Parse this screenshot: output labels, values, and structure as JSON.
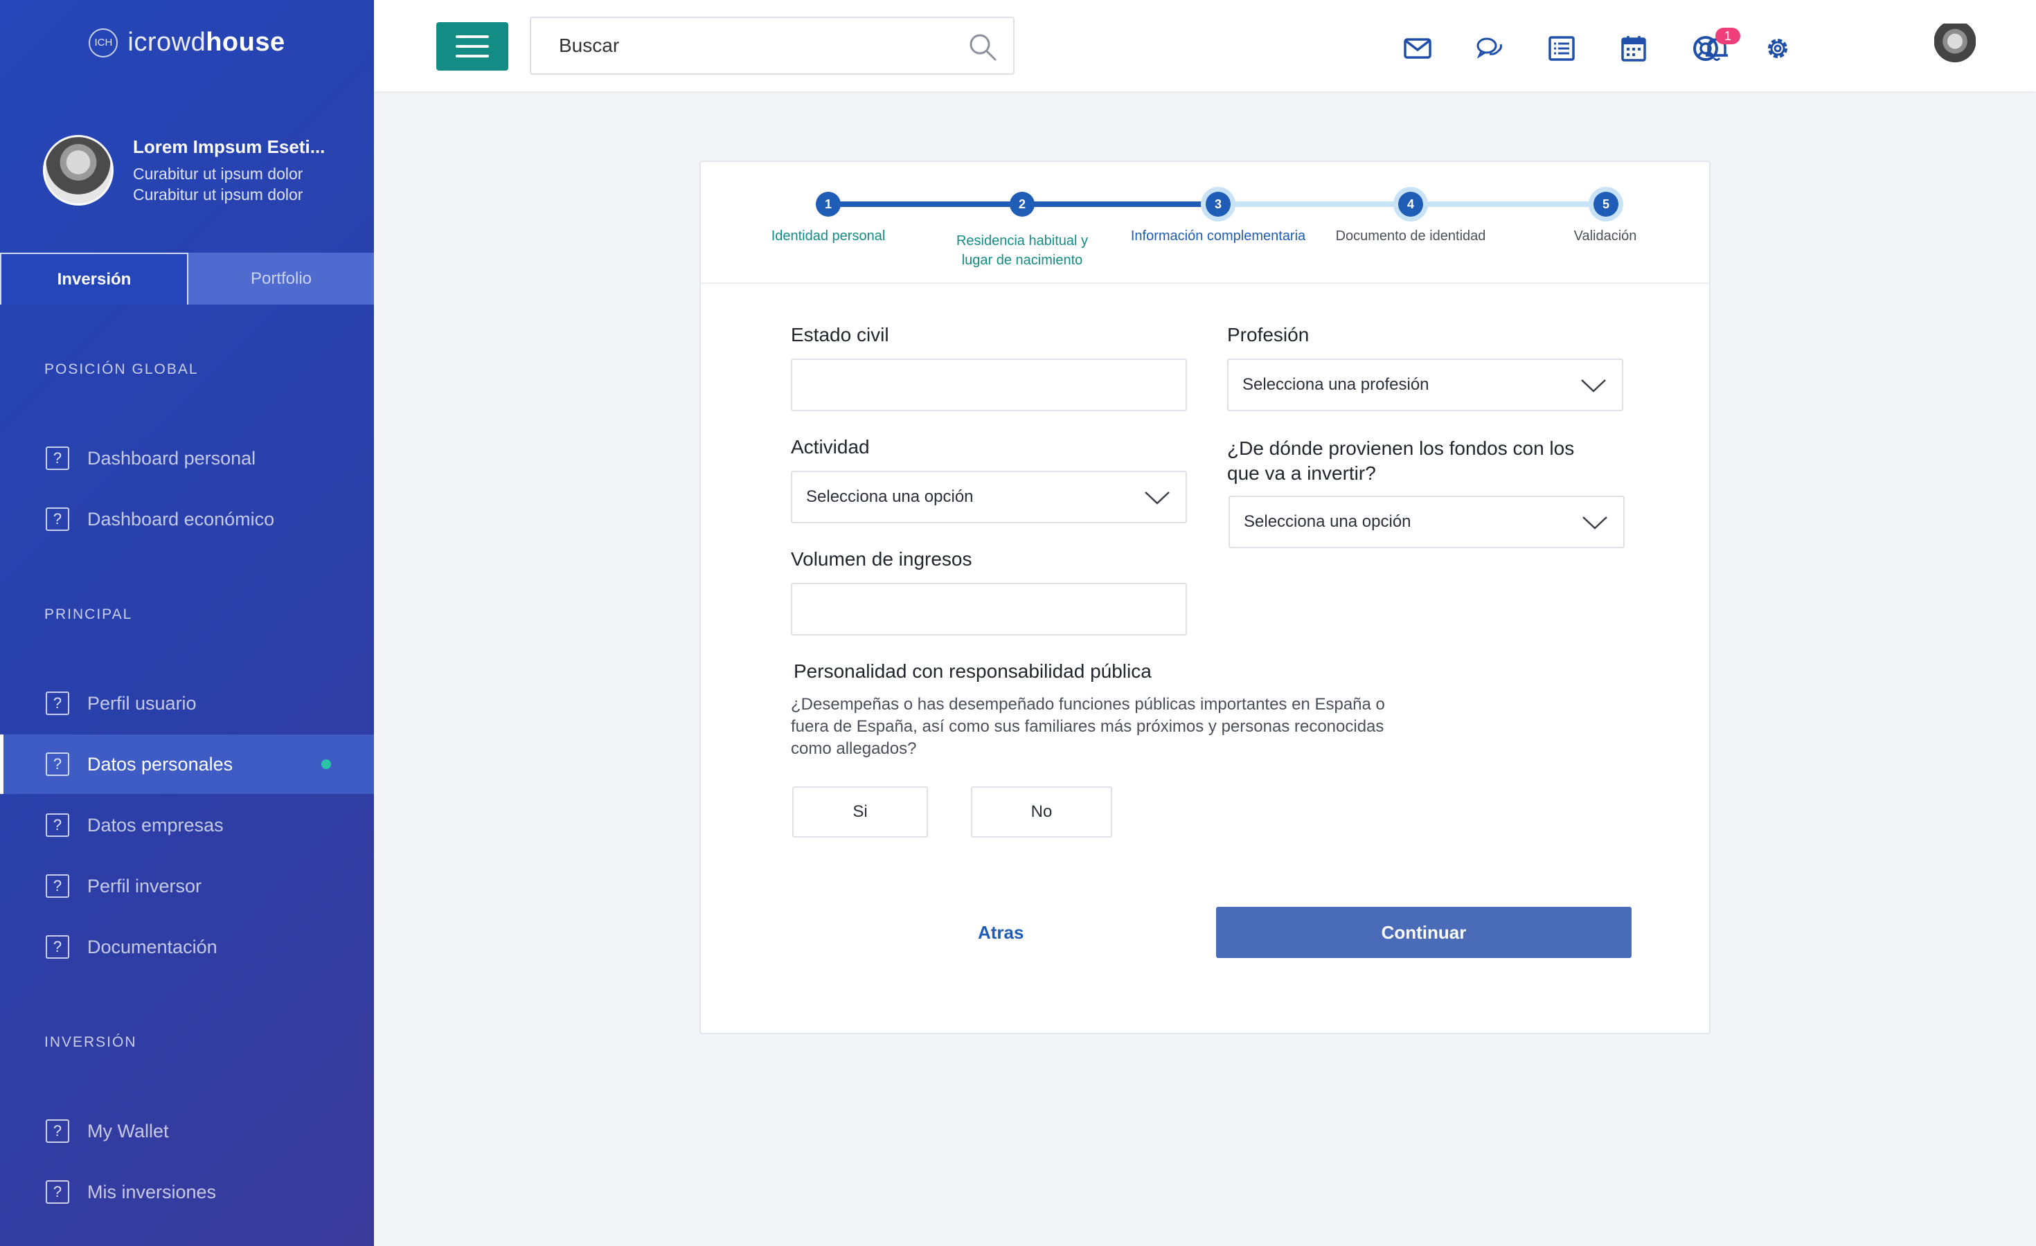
{
  "brand": {
    "mark": "ICH",
    "name_light": "icrowd",
    "name_bold": "house"
  },
  "user": {
    "name": "Lorem Impsum Eseti...",
    "line1": "Curabitur ut ipsum dolor",
    "line2": "Curabitur ut ipsum dolor"
  },
  "side_tabs": [
    {
      "label": "Inversión"
    },
    {
      "label": "Portfolio"
    }
  ],
  "sections": [
    "POSICIÓN GLOBAL",
    "PRINCIPAL",
    "INVERSIÓN"
  ],
  "nav": [
    {
      "label": "Dashboard personal"
    },
    {
      "label": "Dashboard económico"
    },
    {
      "label": "Perfil usuario"
    },
    {
      "label": "Datos personales"
    },
    {
      "label": "Datos empresas"
    },
    {
      "label": "Perfil inversor"
    },
    {
      "label": "Documentación"
    },
    {
      "label": "My Wallet"
    },
    {
      "label": "Mis inversiones"
    }
  ],
  "nav_icon_glyph": "?",
  "search": {
    "placeholder": "Buscar"
  },
  "notifications": {
    "count": "1"
  },
  "steps": [
    {
      "num": "1",
      "label1": "Identidad personal",
      "label2": ""
    },
    {
      "num": "2",
      "label1": "Residencia habitual y",
      "label2": "lugar de nacimiento"
    },
    {
      "num": "3",
      "label1": "Información complementaria",
      "label2": ""
    },
    {
      "num": "4",
      "label1": "Documento de identidad",
      "label2": ""
    },
    {
      "num": "5",
      "label1": "Validación",
      "label2": ""
    }
  ],
  "form": {
    "estado_civil": {
      "label": "Estado civil",
      "value": ""
    },
    "profesion": {
      "label": "Profesión",
      "value": "Selecciona una profesión"
    },
    "actividad": {
      "label": "Actividad",
      "value": "Selecciona una opción"
    },
    "fondos": {
      "label1": "¿De dónde provienen los fondos con los",
      "label2": "que va a invertir?",
      "value": "Selecciona una opción"
    },
    "volumen": {
      "label": "Volumen de ingresos",
      "value": ""
    },
    "personalidad": {
      "label": "Personalidad con responsabilidad pública",
      "hint1": "¿Desempeñas o has desempeñado funciones públicas importantes en España o",
      "hint2": "fuera de España, así como sus familiares más próximos y personas reconocidas",
      "hint3": "como allegados?",
      "yes": "Si",
      "no": "No"
    }
  },
  "actions": {
    "back": "Atras",
    "continue": "Continuar"
  },
  "colors": {
    "sidebar": "#2446b8",
    "accent_teal": "#138c85",
    "primary": "#1f5cb5",
    "continue": "#4a6bb8",
    "badge": "#ef3e7a"
  }
}
